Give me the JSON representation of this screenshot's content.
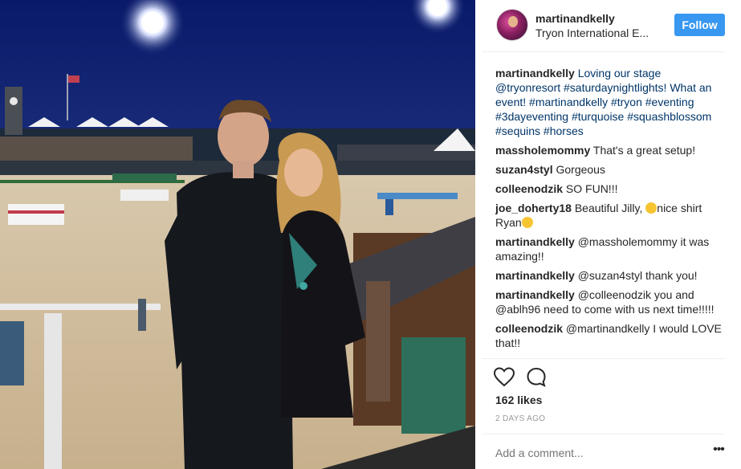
{
  "post": {
    "username": "martinandkelly",
    "location": "Tryon International E...",
    "follow_label": "Follow",
    "likes": "162 likes",
    "time": "2 DAYS AGO",
    "add_comment_placeholder": "Add a comment...",
    "photo_alt": "Photo"
  },
  "caption": {
    "user": "martinandkelly",
    "text": "Loving our stage @tryonresort #saturdaynightlights! What an event! #martinandkelly #tryon #eventing #3dayeventing #turquoise #squashblossom #sequins #horses"
  },
  "comments": [
    {
      "user": "massholemommy",
      "text": "That's a great setup!"
    },
    {
      "user": "suzan4styl",
      "text": "Gorgeous"
    },
    {
      "user": "colleenodzik",
      "text": "SO FUN!!!"
    },
    {
      "user": "joe_doherty18",
      "text_a": "Beautiful Jilly, ",
      "text_b": "nice shirt Ryan"
    },
    {
      "user": "martinandkelly",
      "text": "@massholemommy it was amazing!!"
    },
    {
      "user": "martinandkelly",
      "text": "@suzan4styl thank you!"
    },
    {
      "user": "martinandkelly",
      "text": "@colleenodzik you and @ablh96 need to come with us next time!!!!!"
    },
    {
      "user": "colleenodzik",
      "text": "@martinandkelly I would LOVE that!!"
    }
  ],
  "icons": {
    "like": "heart-icon",
    "comment": "comment-icon",
    "more": "more-icon"
  },
  "colors": {
    "follow_bg": "#3897f0",
    "hashtag": "#003569",
    "muted": "#999999"
  }
}
